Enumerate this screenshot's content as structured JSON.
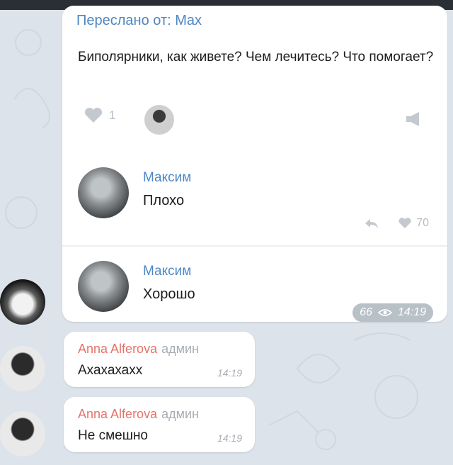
{
  "forwarded": {
    "header": "Переслано от: Max",
    "text": "Биполярники, как живете? Чем лечитесь? Что помогает?",
    "likes": "1"
  },
  "comments": [
    {
      "author": "Максим",
      "text": "Плохо",
      "likes": "70"
    },
    {
      "author": "Максим",
      "text": "Хорошо"
    }
  ],
  "message_meta": {
    "views": "66",
    "time": "14:19"
  },
  "messages": [
    {
      "author": "Anna Alferova",
      "role": "админ",
      "text": "Ахахахахх",
      "time": "14:19"
    },
    {
      "author": "Anna Alferova",
      "role": "админ",
      "text": "Не смешно",
      "time": "14:19"
    }
  ],
  "icons": [
    "heart-icon",
    "reply-icon",
    "megaphone-icon",
    "eye-icon"
  ],
  "colors": {
    "link": "#4f86c2",
    "admin_name": "#e5736b",
    "background": "#dde3ea"
  }
}
